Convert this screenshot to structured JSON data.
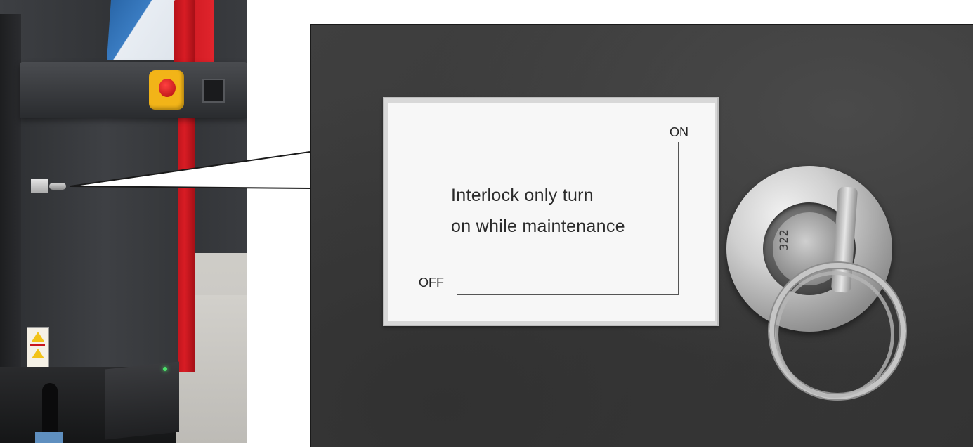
{
  "interlock_label": {
    "on": "ON",
    "off": "OFF",
    "message_line1": "Interlock only turn",
    "message_line2": "on while maintenance"
  },
  "lock": {
    "number": "322"
  },
  "icons": [
    "emergency-stop-icon",
    "keyswitch-icon",
    "warning-sign-icon",
    "key-icon"
  ]
}
